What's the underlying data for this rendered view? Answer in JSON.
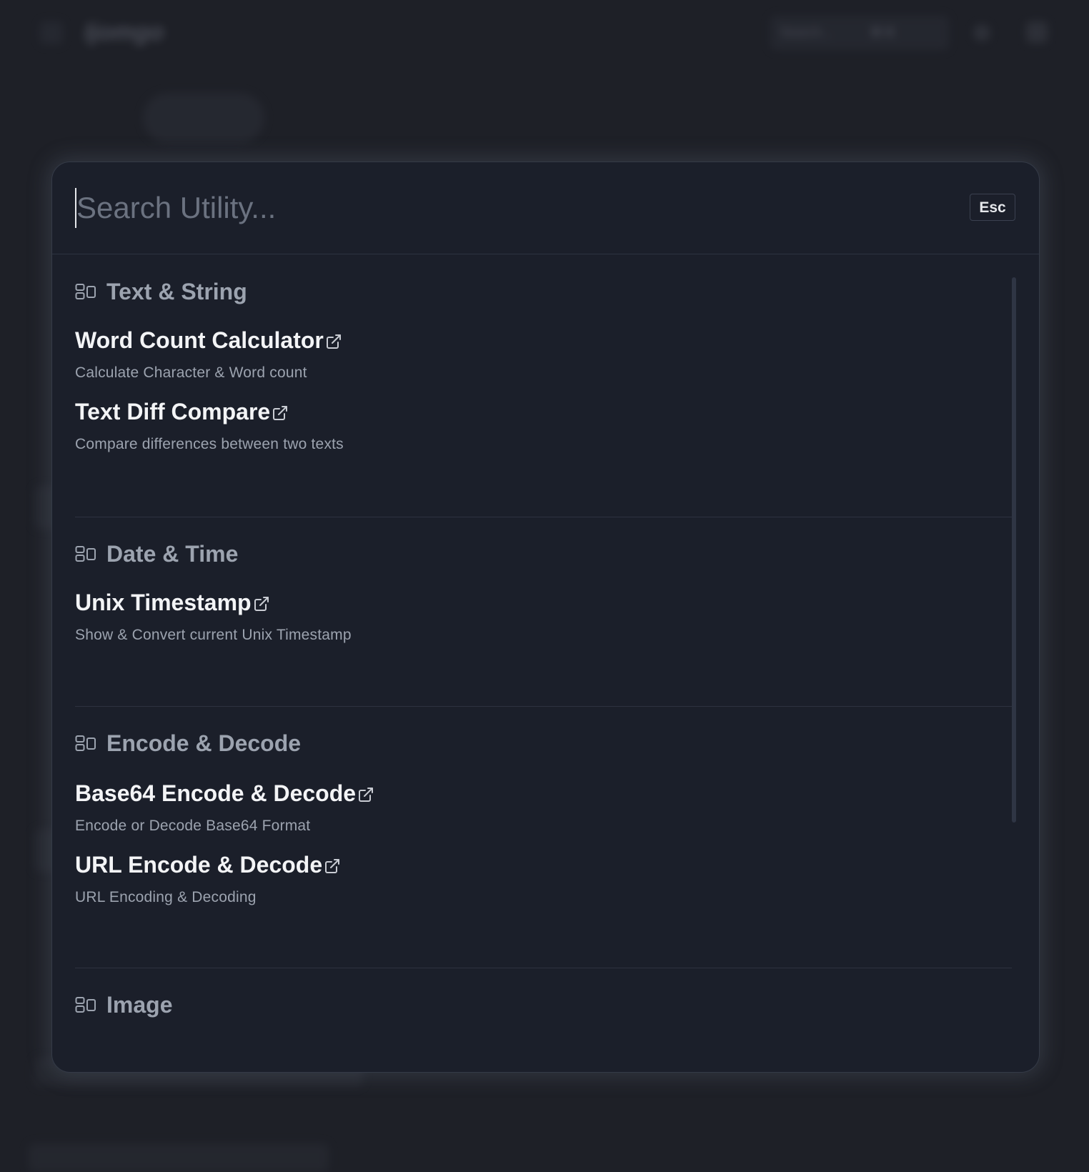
{
  "background": {
    "logo_text": "Ijomgo",
    "search_placeholder": "Search...",
    "search_shortcut": "⌘ K"
  },
  "modal": {
    "search": {
      "placeholder": "Search Utility...",
      "value": ""
    },
    "esc_label": "Esc",
    "sections": [
      {
        "title": "Text & String",
        "icon": "grid-layout-icon",
        "items": [
          {
            "title": "Word Count Calculator",
            "description": "Calculate Character & Word count",
            "icon": "external-link-icon"
          },
          {
            "title": "Text Diff Compare",
            "description": "Compare differences between two texts",
            "icon": "external-link-icon"
          }
        ]
      },
      {
        "title": "Date & Time",
        "icon": "grid-layout-icon",
        "items": [
          {
            "title": "Unix Timestamp",
            "description": "Show & Convert current Unix Timestamp",
            "icon": "external-link-icon"
          }
        ]
      },
      {
        "title": "Encode & Decode",
        "icon": "grid-layout-icon",
        "items": [
          {
            "title": "Base64 Encode & Decode",
            "description": "Encode or Decode Base64 Format",
            "icon": "external-link-icon"
          },
          {
            "title": "URL Encode & Decode",
            "description": "URL Encoding & Decoding",
            "icon": "external-link-icon"
          }
        ]
      },
      {
        "title": "Image",
        "icon": "grid-layout-icon",
        "items": []
      }
    ]
  },
  "colors": {
    "page_background": "#1e2027",
    "modal_background": "#1b1f2a",
    "title_text": "#f3f4f6",
    "muted_text": "#9ca3af",
    "divider": "#2d3240"
  }
}
